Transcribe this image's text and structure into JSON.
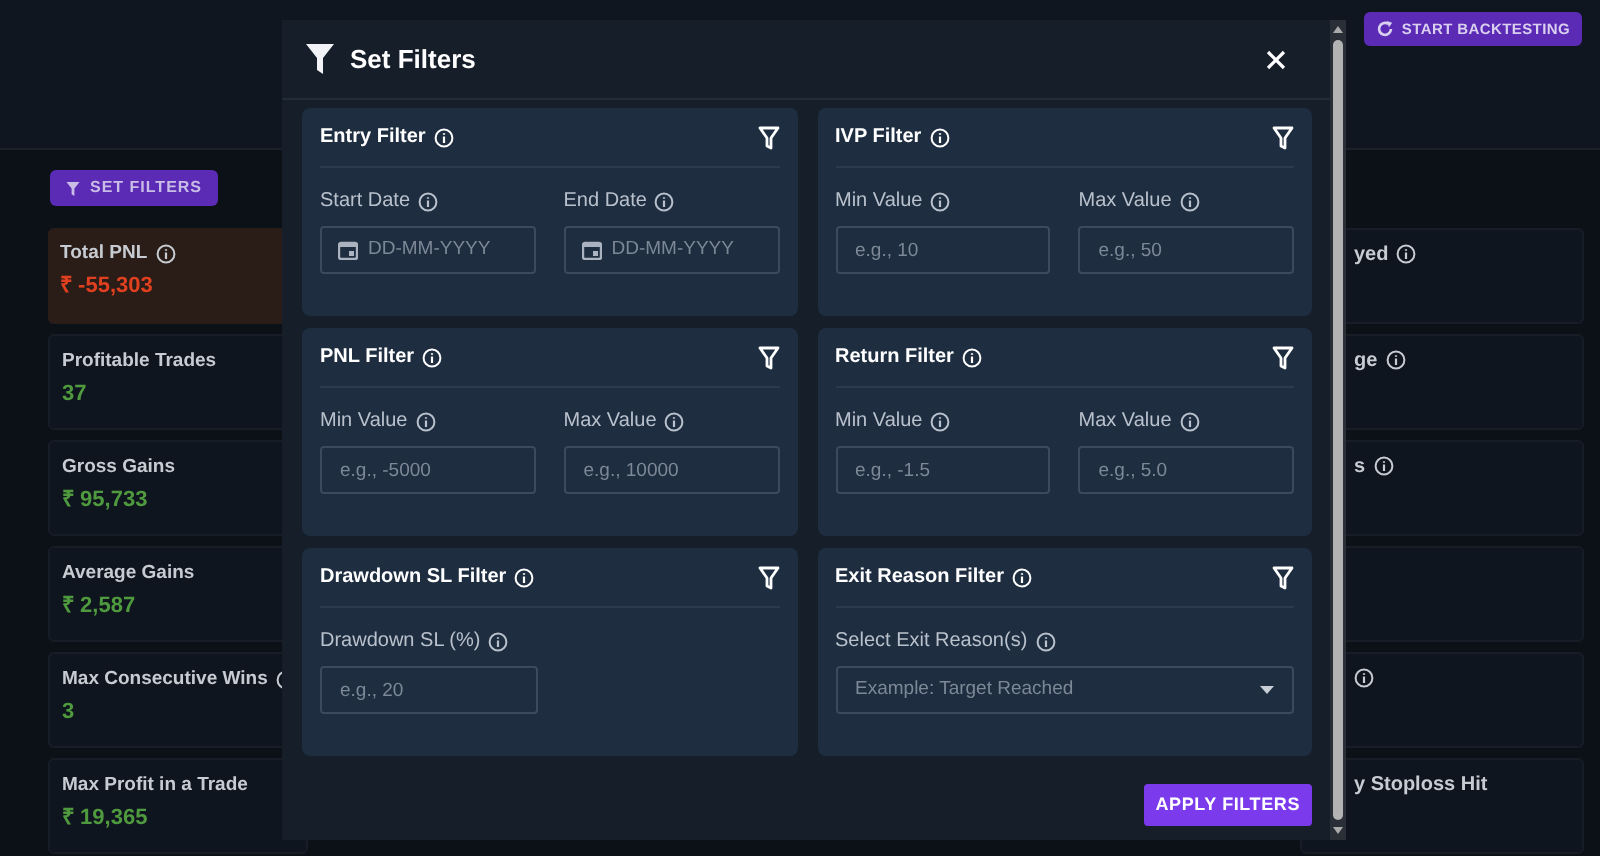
{
  "header": {
    "start_button": "START BACKTESTING"
  },
  "set_filters_button": "SET FILTERS",
  "stats_left": [
    {
      "label": "Total PNL",
      "info": true,
      "value": "₹ -55,303",
      "kind": "negative"
    },
    {
      "label": "Profitable Trades",
      "info": false,
      "value": "37",
      "kind": "positive"
    },
    {
      "label": "Gross Gains",
      "info": false,
      "value": "₹ 95,733",
      "kind": "positive"
    },
    {
      "label": "Average Gains",
      "info": false,
      "value": "₹ 2,587",
      "kind": "positive"
    },
    {
      "label": "Max Consecutive Wins",
      "info": true,
      "value": "3",
      "kind": "positive"
    },
    {
      "label": "Max Profit in a Trade",
      "info": false,
      "value": "₹ 19,365",
      "kind": "positive"
    }
  ],
  "stats_right": [
    {
      "label": "yed",
      "info": true
    },
    {
      "label": "ge",
      "info": true
    },
    {
      "label": "s",
      "info": true
    },
    {
      "info": false
    },
    {
      "info": true
    },
    {
      "label": "y Stoploss Hit",
      "info": false
    }
  ],
  "modal": {
    "title": "Set Filters",
    "filters": [
      {
        "title": "Entry Filter",
        "fields": [
          {
            "kind": "date",
            "label": "Start Date",
            "placeholder": "DD-MM-YYYY"
          },
          {
            "kind": "date",
            "label": "End Date",
            "placeholder": "DD-MM-YYYY"
          }
        ]
      },
      {
        "title": "IVP Filter",
        "fields": [
          {
            "kind": "number",
            "label": "Min Value",
            "placeholder": "e.g., 10"
          },
          {
            "kind": "number",
            "label": "Max Value",
            "placeholder": "e.g., 50"
          }
        ]
      },
      {
        "title": "PNL Filter",
        "fields": [
          {
            "kind": "number",
            "label": "Min Value",
            "placeholder": "e.g., -5000"
          },
          {
            "kind": "number",
            "label": "Max Value",
            "placeholder": "e.g., 10000"
          }
        ]
      },
      {
        "title": "Return Filter",
        "fields": [
          {
            "kind": "number",
            "label": "Min Value",
            "placeholder": "e.g., -1.5"
          },
          {
            "kind": "number",
            "label": "Max Value",
            "placeholder": "e.g., 5.0"
          }
        ]
      },
      {
        "title": "Drawdown SL Filter",
        "fields": [
          {
            "kind": "number",
            "label": "Drawdown SL (%)",
            "placeholder": "e.g., 20"
          }
        ]
      },
      {
        "title": "Exit Reason Filter",
        "fields": [
          {
            "kind": "select",
            "label": "Select Exit Reason(s)",
            "placeholder": "Example: Target Reached"
          }
        ]
      }
    ],
    "apply_button": "APPLY FILTERS"
  }
}
